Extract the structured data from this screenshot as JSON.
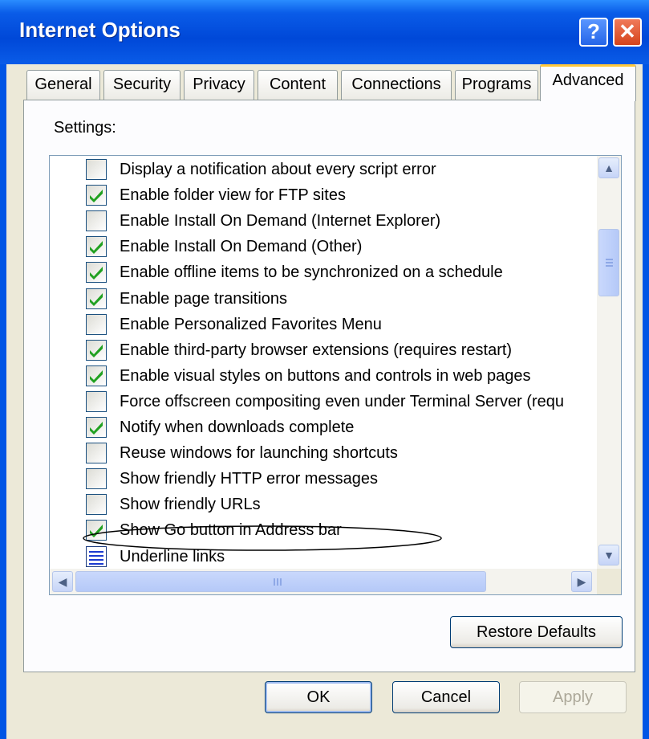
{
  "window": {
    "title": "Internet Options",
    "help_glyph": "?",
    "close_glyph": "✕"
  },
  "tabs": [
    {
      "label": "General"
    },
    {
      "label": "Security"
    },
    {
      "label": "Privacy"
    },
    {
      "label": "Content"
    },
    {
      "label": "Connections"
    },
    {
      "label": "Programs"
    },
    {
      "label": "Advanced",
      "active": true
    }
  ],
  "settings": {
    "label": "Settings:",
    "items": [
      {
        "label": "Display a notification about every script error",
        "checked": false
      },
      {
        "label": "Enable folder view for FTP sites",
        "checked": true
      },
      {
        "label": "Enable Install On Demand (Internet Explorer)",
        "checked": false
      },
      {
        "label": "Enable Install On Demand (Other)",
        "checked": true
      },
      {
        "label": "Enable offline items to be synchronized on a schedule",
        "checked": true
      },
      {
        "label": "Enable page transitions",
        "checked": true
      },
      {
        "label": "Enable Personalized Favorites Menu",
        "checked": false
      },
      {
        "label": "Enable third-party browser extensions (requires restart)",
        "checked": true
      },
      {
        "label": "Enable visual styles on buttons and controls in web pages",
        "checked": true
      },
      {
        "label": "Force offscreen compositing even under Terminal Server (requ",
        "checked": false
      },
      {
        "label": "Notify when downloads complete",
        "checked": true
      },
      {
        "label": "Reuse windows for launching shortcuts",
        "checked": false,
        "highlighted": true
      },
      {
        "label": "Show friendly HTTP error messages",
        "checked": false
      },
      {
        "label": "Show friendly URLs",
        "checked": false
      },
      {
        "label": "Show Go button in Address bar",
        "checked": true
      },
      {
        "label": "Underline links",
        "checked": null,
        "icon": "group-list-icon"
      }
    ]
  },
  "scrollbars": {
    "up_glyph": "▲",
    "down_glyph": "▼",
    "left_glyph": "◀",
    "right_glyph": "▶"
  },
  "buttons": {
    "restore_defaults": "Restore Defaults",
    "ok": "OK",
    "cancel": "Cancel",
    "apply": "Apply"
  },
  "colors": {
    "titlebar": "#0a5ce8",
    "dialog_bg": "#ece9d8",
    "checkmark": "#21a121",
    "active_tab_accent": "#ffc83c"
  }
}
